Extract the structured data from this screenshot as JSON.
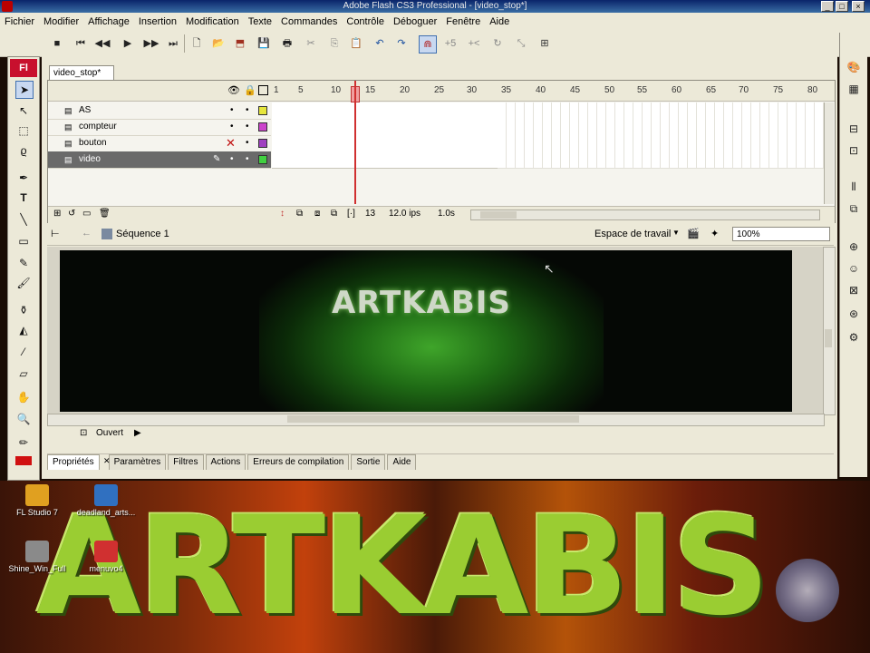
{
  "window": {
    "title": "Adobe Flash CS3 Professional - [video_stop*]"
  },
  "menu": [
    "Fichier",
    "Modifier",
    "Affichage",
    "Insertion",
    "Modification",
    "Texte",
    "Commandes",
    "Contrôle",
    "Déboguer",
    "Fenêtre",
    "Aide"
  ],
  "tools": {
    "logo": "Fl"
  },
  "document": {
    "tab": "video_stop*"
  },
  "timeline": {
    "frame_numbers": [
      "1",
      "5",
      "10",
      "15",
      "20",
      "25",
      "30",
      "35",
      "40",
      "45",
      "50",
      "55",
      "60",
      "65",
      "70",
      "75",
      "80"
    ],
    "layers": [
      {
        "name": "AS",
        "color": "#e6e63c",
        "selected": false
      },
      {
        "name": "compteur",
        "color": "#cc44cc",
        "selected": false
      },
      {
        "name": "bouton",
        "color": "#a040c0",
        "selected": false
      },
      {
        "name": "video",
        "color": "#40d040",
        "selected": true
      }
    ],
    "current_frame": "13",
    "fps": "12.0 ips",
    "time": "1.0s"
  },
  "scene": {
    "label": "Séquence 1",
    "workspace": "Espace de travail",
    "zoom": "100%"
  },
  "stage": {
    "text": "ARTKABIS"
  },
  "actions_bar": {
    "label": "Ouvert"
  },
  "panel_tabs": [
    "Propriétés",
    "Paramètres",
    "Filtres",
    "Actions",
    "Erreurs de compilation",
    "Sortie",
    "Aide"
  ],
  "desktop": {
    "wallpaper_text": "ARTKABIS",
    "icons": [
      {
        "label": "FL Studio 7",
        "color": "#e0a020"
      },
      {
        "label": "deadland_arts...",
        "color": "#3070c0"
      },
      {
        "label": "Shine_Win_Full",
        "color": "#8a8a8a"
      },
      {
        "label": "menuvo4",
        "color": "#d03030"
      }
    ]
  }
}
